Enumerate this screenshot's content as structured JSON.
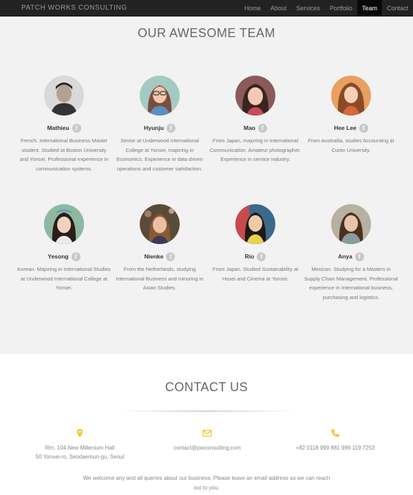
{
  "navbar": {
    "brand": "PATCH WORKS CONSULTING",
    "items": [
      {
        "label": "Home"
      },
      {
        "label": "About"
      },
      {
        "label": "Services"
      },
      {
        "label": "Portfolio"
      },
      {
        "label": "Team"
      },
      {
        "label": "Contact"
      }
    ],
    "active": "Team"
  },
  "team": {
    "title": "OUR AWESOME TEAM",
    "members": [
      {
        "name": "Mathieu",
        "bio": "French. International Business Master student. Studied at Boston University and Yonsei. Professional experience in communication systems."
      },
      {
        "name": "Hyunju",
        "bio": "Senior at Underwood International College at Yonsei, majoring in Economics. Experience in data driven operations and customer satisfaction."
      },
      {
        "name": "Mao",
        "bio": "From Japan, majoring in International Communication. Amateur photographer. Experience in service industry."
      },
      {
        "name": "Hee Lee",
        "bio": "From Austrailia, studies Accounting at Curtin University."
      },
      {
        "name": "Yesong",
        "bio": "Korean. Majoring in International Studies at Underwood International College at Yonsei."
      },
      {
        "name": "Nienke",
        "bio": "From the Netherlands, studying International Business and minoring in Asian Studies."
      },
      {
        "name": "Rio",
        "bio": "From Japan. Studied Sustainability at Hosei and Cinema at Yonsei."
      },
      {
        "name": "Anya",
        "bio": "Mexican. Studying for a Masters in Supply Chain Management. Professional experience in International business, purchasing and logistics."
      }
    ],
    "social_glyph": "f"
  },
  "contact": {
    "title": "CONTACT US",
    "address_line1": "Rm. 104 New Millenium Hall",
    "address_line2": "50 Yonsei-ro, Seodaemun-gu, Seoul",
    "email": "contact@pwconsulting.com",
    "phone": "+82 0118 999 881 999 119 7253",
    "welcome": "We welcome any and all queries about our business. Please leave an email address so we can reach out to you.",
    "icons": {
      "address": "map-marker-icon",
      "email": "envelope-icon",
      "phone": "phone-icon"
    },
    "accent_color": "#f5c518"
  }
}
